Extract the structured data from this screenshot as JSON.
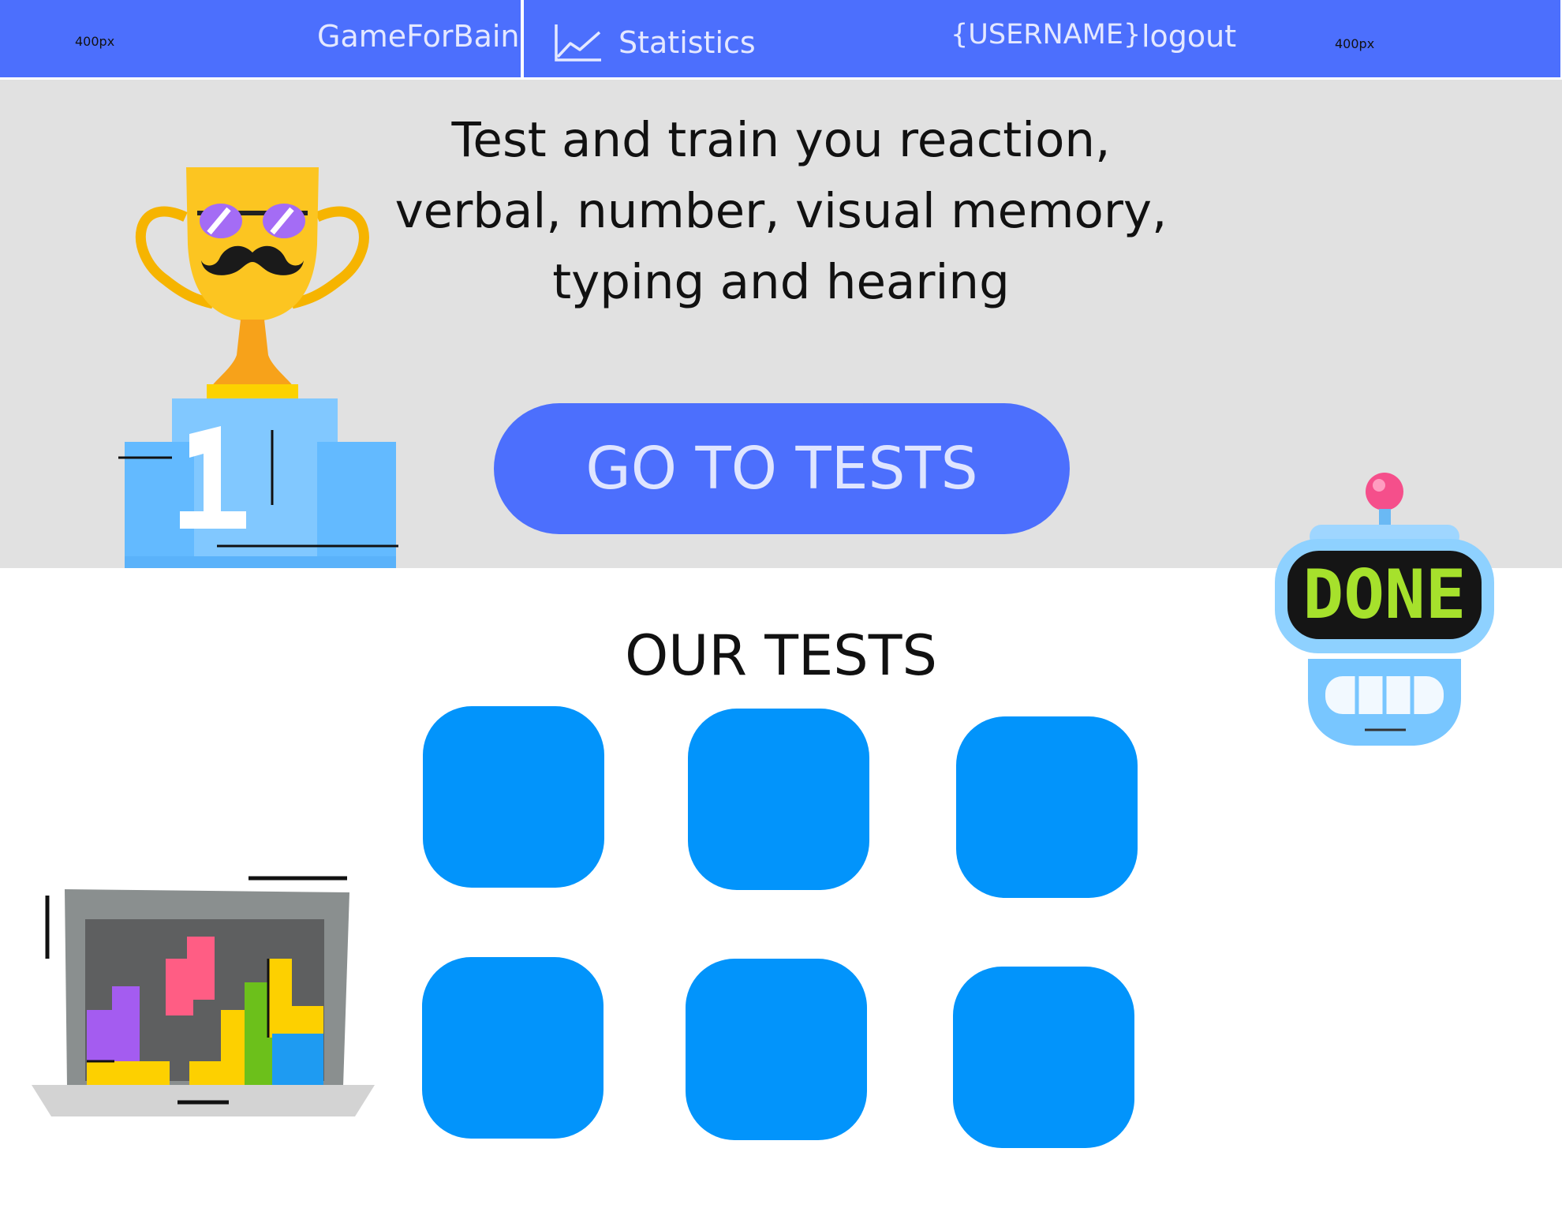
{
  "header": {
    "left_px_label": "400px",
    "right_px_label": "400px",
    "brand": "GameForBain",
    "statistics_label": "Statistics",
    "username": "{USERNAME}",
    "logout_label": "logout",
    "background_color": "#4c6ffd",
    "statistics_icon": "line-chart-icon"
  },
  "hero": {
    "lines": [
      "Test and train you reaction,",
      "verbal, number, visual memory,",
      "typing and hearing"
    ],
    "cta_label": "GO TO TESTS",
    "background_color": "#e1e1e1",
    "illustrations": [
      "trophy-podium-illustration",
      "done-robot-illustration",
      "tetris-laptop-illustration"
    ]
  },
  "tests": {
    "title": "OUR TESTS",
    "tile_color": "#0294fb",
    "tile_count": 6
  }
}
